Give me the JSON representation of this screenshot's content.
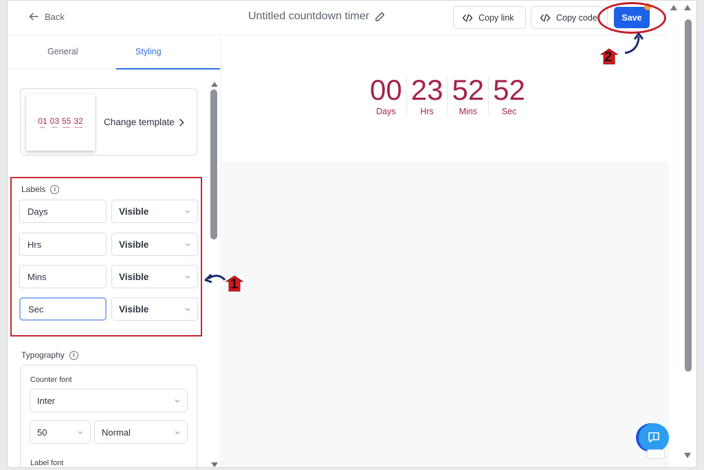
{
  "topbar": {
    "back_label": "Back",
    "title": "Untitled countdown timer",
    "copy_link_label": "Copy link",
    "copy_code_label": "Copy code",
    "save_label": "Save"
  },
  "tabs": [
    {
      "label": "General"
    },
    {
      "label": "Styling"
    }
  ],
  "template": {
    "change_label": "Change template",
    "thumb": [
      {
        "n": "01",
        "l": "Days"
      },
      {
        "n": "03",
        "l": "Hours"
      },
      {
        "n": "55",
        "l": "Minutes"
      },
      {
        "n": "32",
        "l": "Seconds"
      }
    ]
  },
  "labels": {
    "title": "Labels",
    "rows": [
      {
        "value": "Days",
        "visibility": "Visible"
      },
      {
        "value": "Hrs",
        "visibility": "Visible"
      },
      {
        "value": "Mins",
        "visibility": "Visible"
      },
      {
        "value": "Sec",
        "visibility": "Visible"
      }
    ]
  },
  "typography": {
    "title": "Typography",
    "counter_font_label": "Counter font",
    "counter_font": "Inter",
    "size": "50",
    "weight": "Normal",
    "label_font_label": "Label font"
  },
  "preview": {
    "units": [
      {
        "num": "00",
        "label": "Days"
      },
      {
        "num": "23",
        "label": "Hrs"
      },
      {
        "num": "52",
        "label": "Mins"
      },
      {
        "num": "52",
        "label": "Sec"
      }
    ]
  },
  "annotations": {
    "step1": "1",
    "step2": "2"
  },
  "colors": {
    "accent": "#2f6fdc",
    "save": "#1e60e6",
    "counter": "#a4224f",
    "callout": "#c7272d"
  }
}
